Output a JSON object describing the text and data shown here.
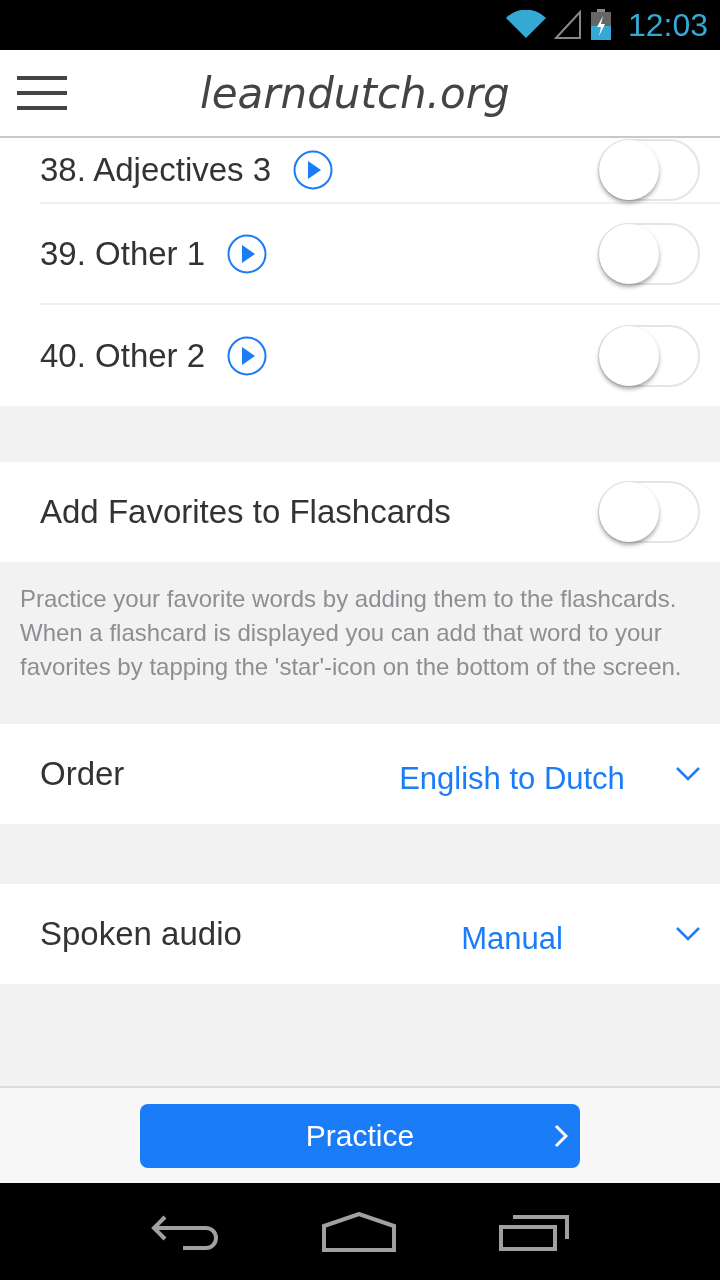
{
  "status_bar": {
    "time": "12:03"
  },
  "header": {
    "logo": "learndutch.org"
  },
  "lessons": [
    {
      "label": "38. Adjectives 3",
      "on": false
    },
    {
      "label": "39. Other 1",
      "on": false
    },
    {
      "label": "40. Other 2",
      "on": false
    }
  ],
  "favorites": {
    "label": "Add Favorites to Flashcards",
    "on": false,
    "description": "Practice your favorite words by adding them to the flashcards. When a flashcard is displayed you can add that word to your favorites by tapping the 'star'-icon on the bottom of the screen."
  },
  "settings": [
    {
      "label": "Order",
      "value": "English to Dutch"
    },
    {
      "label": "Spoken audio",
      "value": "Manual"
    }
  ],
  "practice_button": {
    "label": "Practice"
  }
}
